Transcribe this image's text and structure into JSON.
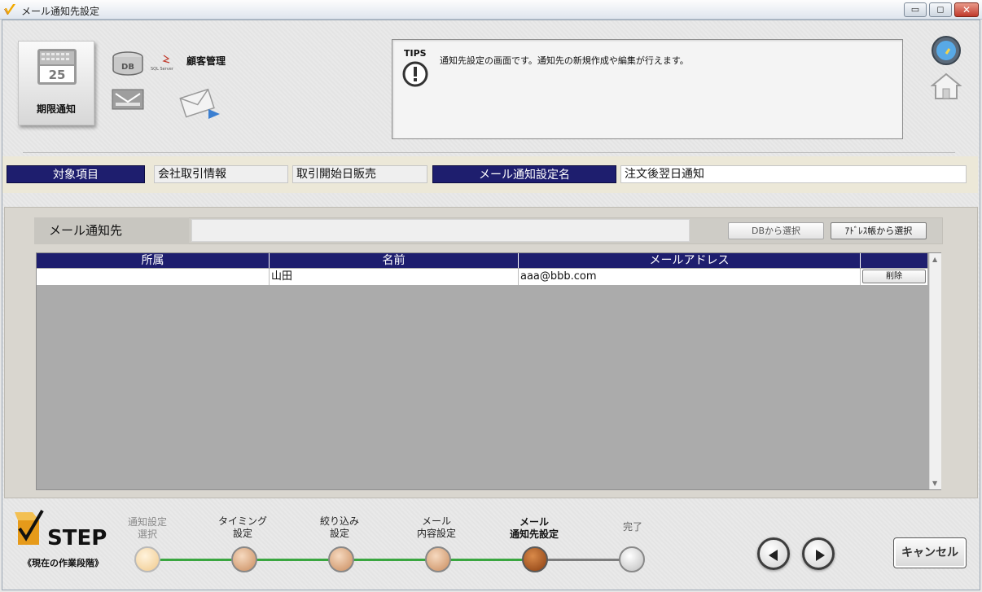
{
  "window": {
    "title": "メール通知先設定"
  },
  "header": {
    "kigen_label": "期限通知",
    "calendar_day": "25",
    "db_label": "DB",
    "customer_label": "顧客管理"
  },
  "tips": {
    "title": "TIPS",
    "text": "通知先設定の画面です。通知先の新規作成や編集が行えます。"
  },
  "target": {
    "label": "対象項目",
    "company_value": "会社取引情報",
    "start_value": "取引開始日販売",
    "setting_label": "メール通知設定名",
    "setting_value": "注文後翌日通知"
  },
  "recipients": {
    "title": "メール通知先",
    "db_button": "DBから選択",
    "address_button": "ｱﾄﾞﾚｽ帳から選択",
    "columns": [
      "所属",
      "名前",
      "メールアドレス",
      ""
    ],
    "rows": [
      {
        "affiliation": "",
        "name": "山田",
        "email": "aaa@bbb.com",
        "delete_label": "削除"
      }
    ]
  },
  "steps": {
    "subtitle": "《現在の作業段階》",
    "items": [
      {
        "label": "通知設定\n選択",
        "state": "done"
      },
      {
        "label": "タイミング\n設定",
        "state": "normal"
      },
      {
        "label": "絞り込み\n設定",
        "state": "normal"
      },
      {
        "label": "メール\n内容設定",
        "state": "normal"
      },
      {
        "label": "メール\n通知先設定",
        "state": "current"
      },
      {
        "label": "完了",
        "state": "pending"
      }
    ]
  },
  "footer": {
    "cancel_label": "キャンセル"
  },
  "colors": {
    "navy": "#1e1e6e",
    "progress_green": "#3aa640",
    "current_step": "#a6551d"
  }
}
